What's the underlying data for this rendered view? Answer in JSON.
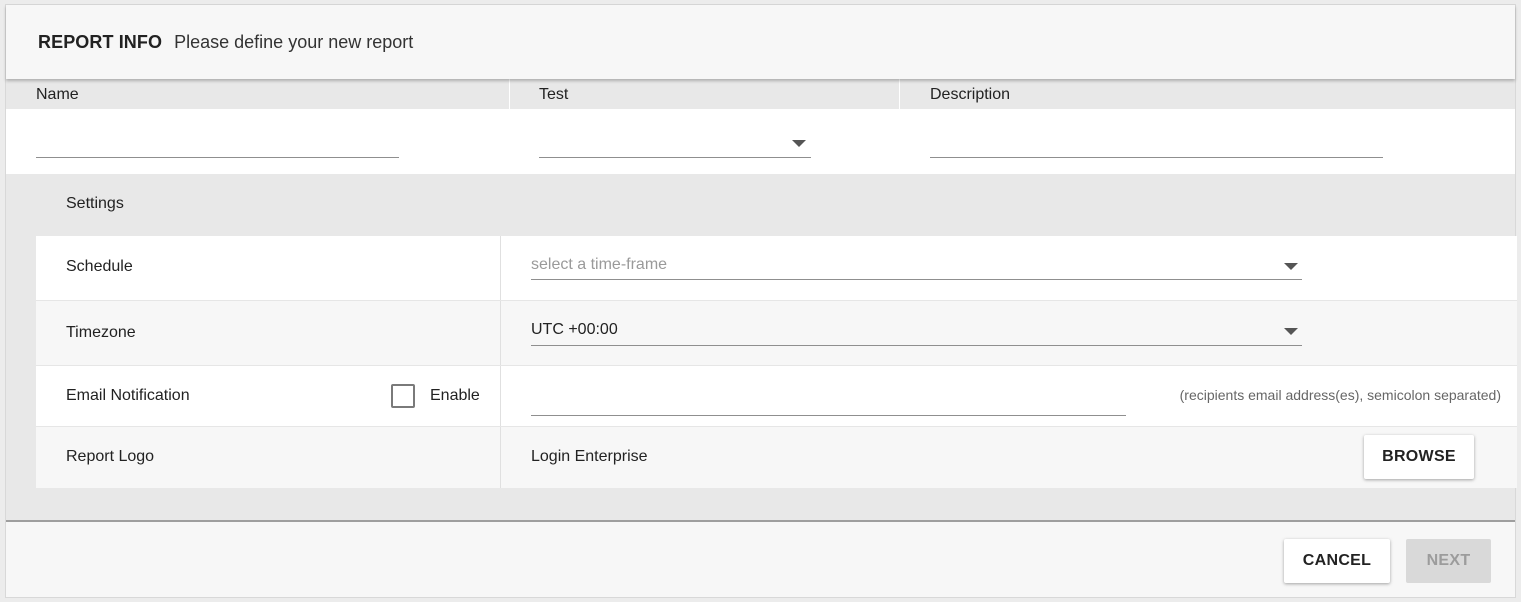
{
  "header": {
    "title": "REPORT INFO",
    "subtitle": "Please define your new report"
  },
  "columns": {
    "name_label": "Name",
    "test_label": "Test",
    "description_label": "Description"
  },
  "fields": {
    "name_value": "",
    "test_value": "",
    "description_value": ""
  },
  "settings": {
    "title": "Settings",
    "schedule": {
      "label": "Schedule",
      "placeholder": "select a time-frame"
    },
    "timezone": {
      "label": "Timezone",
      "value": "UTC +00:00"
    },
    "email": {
      "label": "Email Notification",
      "enable_label": "Enable",
      "enabled": false,
      "value": "",
      "hint": "(recipients email address(es), semicolon separated)"
    },
    "logo": {
      "label": "Report Logo",
      "value": "Login Enterprise",
      "browse_label": "BROWSE"
    }
  },
  "footer": {
    "cancel_label": "CANCEL",
    "next_label": "NEXT"
  },
  "icons": {
    "dropdown": "chevron-down-icon",
    "checkbox": "checkbox-unchecked-icon"
  },
  "colors": {
    "header_bg": "#f7f7f7",
    "band_bg": "#e8e8e8",
    "disabled_button_bg": "#d9d9d9",
    "disabled_button_text": "#9c9c9c"
  }
}
